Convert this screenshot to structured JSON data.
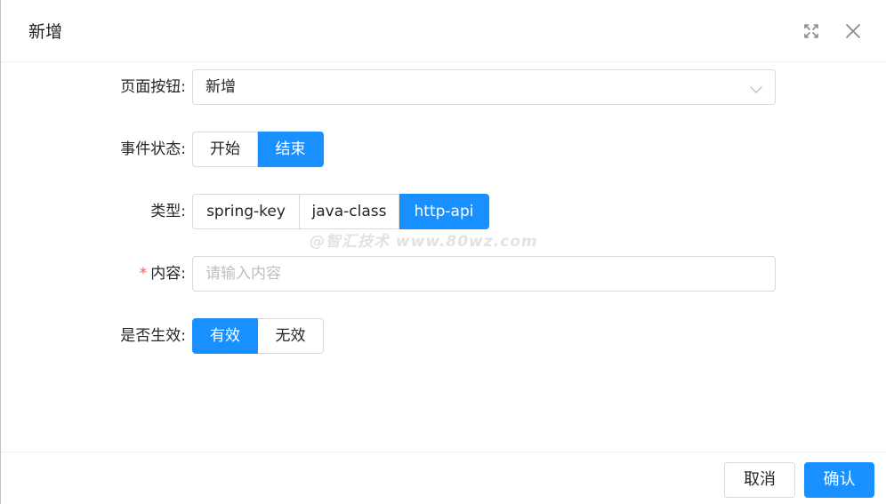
{
  "dialog": {
    "title": "新增",
    "icons": {
      "fullscreen": "fullscreen-icon",
      "close": "close-icon"
    }
  },
  "form": {
    "page_button": {
      "label": "页面按钮:",
      "value": "新增"
    },
    "event_status": {
      "label": "事件状态:",
      "options": [
        "开始",
        "结束"
      ],
      "selected": "结束"
    },
    "type": {
      "label": "类型:",
      "options": [
        "spring-key",
        "java-class",
        "http-api"
      ],
      "selected": "http-api"
    },
    "content": {
      "required_mark": "*",
      "label": "内容:",
      "value": "",
      "placeholder": "请输入内容"
    },
    "is_valid": {
      "label": "是否生效:",
      "options": [
        "有效",
        "无效"
      ],
      "selected": "有效"
    }
  },
  "watermark": "@智汇技术 www.80wz.com",
  "footer": {
    "cancel_label": "取消",
    "ok_label": "确认"
  },
  "colors": {
    "primary": "#1890ff",
    "border": "#d9d9d9",
    "required": "#ff4d4f",
    "placeholder": "#bfbfbf"
  }
}
